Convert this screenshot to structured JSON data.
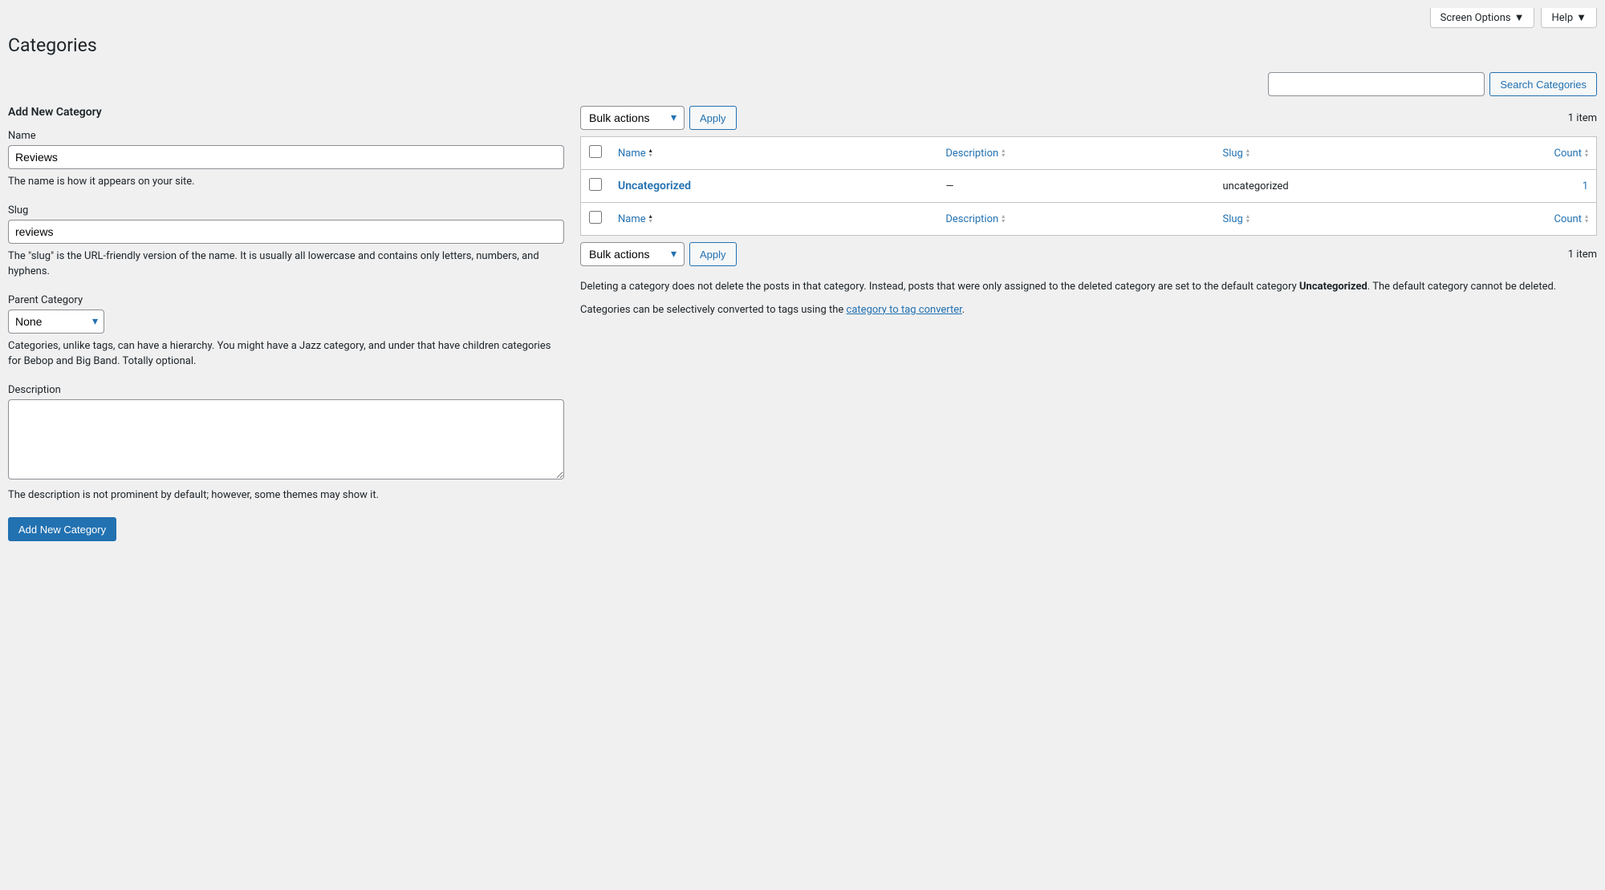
{
  "topbar": {
    "screen_options": "Screen Options",
    "help": "Help"
  },
  "page_title": "Categories",
  "search": {
    "button": "Search Categories"
  },
  "form": {
    "heading": "Add New Category",
    "name_label": "Name",
    "name_value": "Reviews",
    "name_help": "The name is how it appears on your site.",
    "slug_label": "Slug",
    "slug_value": "reviews",
    "slug_help": "The \"slug\" is the URL-friendly version of the name. It is usually all lowercase and contains only letters, numbers, and hyphens.",
    "parent_label": "Parent Category",
    "parent_value": "None",
    "parent_help": "Categories, unlike tags, can have a hierarchy. You might have a Jazz category, and under that have children categories for Bebop and Big Band. Totally optional.",
    "description_label": "Description",
    "description_help": "The description is not prominent by default; however, some themes may show it.",
    "submit": "Add New Category"
  },
  "bulk": {
    "label": "Bulk actions",
    "apply": "Apply"
  },
  "pagination": {
    "count_text": "1 item"
  },
  "columns": {
    "name": "Name",
    "description": "Description",
    "slug": "Slug",
    "count": "Count"
  },
  "rows": [
    {
      "name": "Uncategorized",
      "description": "—",
      "slug": "uncategorized",
      "count": "1"
    }
  ],
  "notes": {
    "p1_a": "Deleting a category does not delete the posts in that category. Instead, posts that were only assigned to the deleted category are set to the default category ",
    "p1_bold": "Uncategorized",
    "p1_b": ". The default category cannot be deleted.",
    "p2_a": "Categories can be selectively converted to tags using the ",
    "p2_link": "category to tag converter",
    "p2_b": "."
  }
}
